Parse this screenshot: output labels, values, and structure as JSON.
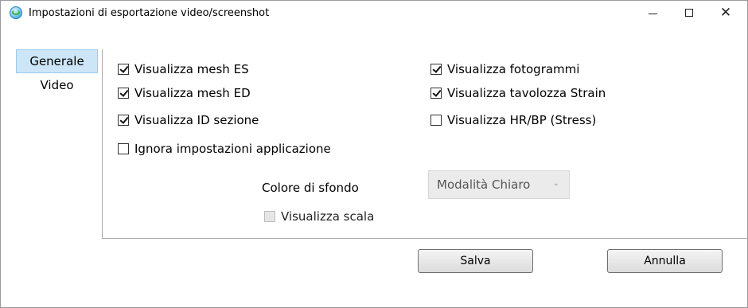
{
  "window": {
    "title": "Impostazioni di esportazione video/screenshot",
    "controls": {
      "minimize": "—",
      "maximize": "☐",
      "close": "✕"
    }
  },
  "tabs": [
    {
      "label": "Generale",
      "selected": true
    },
    {
      "label": "Video",
      "selected": false
    }
  ],
  "options": {
    "mesh_es": {
      "label": "Visualizza mesh ES",
      "checked": true
    },
    "mesh_ed": {
      "label": "Visualizza mesh ED",
      "checked": true
    },
    "id_sezione": {
      "label": "Visualizza ID sezione",
      "checked": true
    },
    "fotogrammi": {
      "label": "Visualizza fotogrammi",
      "checked": true
    },
    "tavolozza_strain": {
      "label": "Visualizza tavolozza Strain",
      "checked": true
    },
    "hr_bp": {
      "label": "Visualizza HR/BP (Stress)",
      "checked": false
    },
    "ignora_impostazioni": {
      "label": "Ignora impostazioni applicazione",
      "checked": false
    },
    "scala": {
      "label": "Visualizza scala",
      "checked": false,
      "disabled": true
    }
  },
  "background": {
    "label": "Colore di sfondo",
    "selected": "Modalità Chiaro",
    "chevron": "⌄"
  },
  "buttons": {
    "save": "Salva",
    "cancel": "Annulla"
  }
}
